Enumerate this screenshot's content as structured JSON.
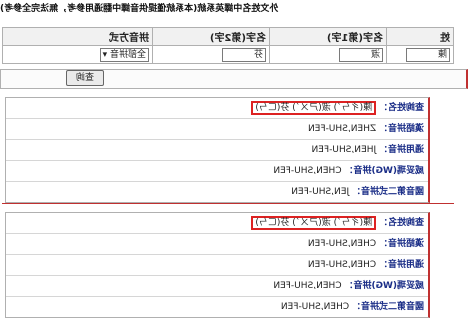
{
  "note": "外文姓名中譯英系統(本系統僅提供音譯中翻通用參考，無法完全參考)",
  "form": {
    "headers": [
      "姓",
      "名字(第1字)",
      "名字(第2字)",
      "拼音方式"
    ],
    "surname_value": "陳",
    "given1_value": "淑",
    "given2_value": "芬",
    "pinyin_select": "全部拼音"
  },
  "query_button": "查詢",
  "results": [
    {
      "query_label": "查詢姓名：",
      "query_text": "陳(ㄔㄣˊ) 淑(ㄕㄨˊ) 芬(ㄈㄣ)",
      "rows": [
        {
          "label": "漢語拼音：",
          "value": "ZHEN,SHU-FEN"
        },
        {
          "label": "通用拼音：",
          "value": "JHEN,SHU-FEN"
        },
        {
          "label": "威妥瑪(WG)拼音：",
          "value": "CHEN,SHU-FEN"
        },
        {
          "label": "國音第二式拼音：",
          "value": "JEN,SHU-FEN"
        }
      ]
    },
    {
      "query_label": "查詢姓名：",
      "query_text": "陳(ㄔㄣˊ) 淑(ㄕㄨˊ) 芬(ㄈㄣ)",
      "rows": [
        {
          "label": "漢語拼音：",
          "value": "CHEN,SHU-FEN"
        },
        {
          "label": "通用拼音：",
          "value": "CHEN,SHU-FEN"
        },
        {
          "label": "威妥瑪(WG)拼音：",
          "value": "CHEN,SHU-FEN"
        },
        {
          "label": "國音第二式拼音：",
          "value": "CHEN,SHU-FEN"
        }
      ]
    }
  ]
}
